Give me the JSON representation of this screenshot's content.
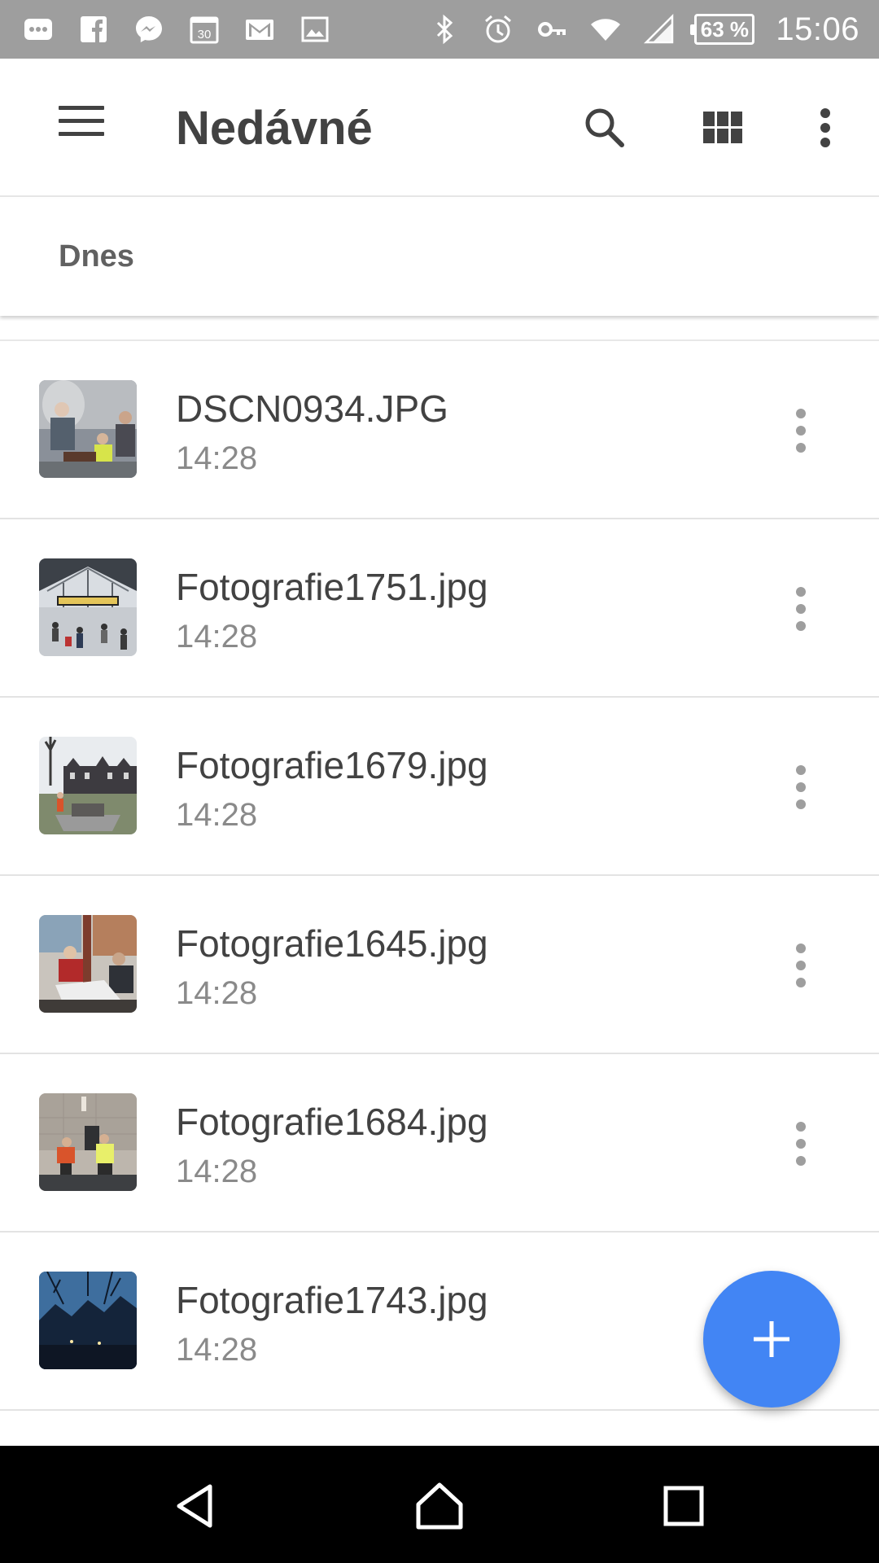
{
  "status_bar": {
    "battery": "63 %",
    "time": "15:06",
    "left_icons": [
      "messages-icon",
      "facebook-icon",
      "messenger-icon",
      "calendar-icon",
      "gmail-icon",
      "gallery-icon"
    ],
    "right_icons": [
      "bluetooth-icon",
      "alarm-icon",
      "vpn-key-icon",
      "wifi-icon",
      "signal-icon"
    ]
  },
  "app_bar": {
    "title": "Nedávné",
    "icons": [
      "menu-icon",
      "search-icon",
      "grid-view-icon",
      "more-vert-icon"
    ]
  },
  "section": {
    "label": "Dnes"
  },
  "files": [
    {
      "name": "DSCN0934.JPG",
      "time": "14:28",
      "thumb": "outdoor-people-smoke"
    },
    {
      "name": "Fotografie1751.jpg",
      "time": "14:28",
      "thumb": "train-station"
    },
    {
      "name": "Fotografie1679.jpg",
      "time": "14:28",
      "thumb": "castle-courtyard"
    },
    {
      "name": "Fotografie1645.jpg",
      "time": "14:28",
      "thumb": "train-interior"
    },
    {
      "name": "Fotografie1684.jpg",
      "time": "14:28",
      "thumb": "people-at-wall"
    },
    {
      "name": "Fotografie1743.jpg",
      "time": "14:28",
      "thumb": "night-trees"
    }
  ],
  "fab": {
    "icon": "add-icon"
  },
  "colors": {
    "accent": "#4285f4",
    "status_bar": "#9e9e9e",
    "nav_bar": "#000000"
  }
}
